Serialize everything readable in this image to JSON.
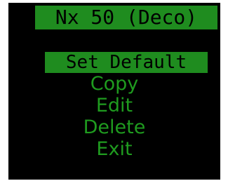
{
  "screen": {
    "title": "Nx 50 (Deco)"
  },
  "menu": {
    "items": [
      {
        "label": "Set Default",
        "selected": true
      },
      {
        "label": "Copy",
        "selected": false
      },
      {
        "label": "Edit",
        "selected": false
      },
      {
        "label": "Delete",
        "selected": false
      },
      {
        "label": "Exit",
        "selected": false
      }
    ]
  },
  "colors": {
    "background": "#000000",
    "accent": "#1f8c1f",
    "text": "#1f9b1f"
  }
}
